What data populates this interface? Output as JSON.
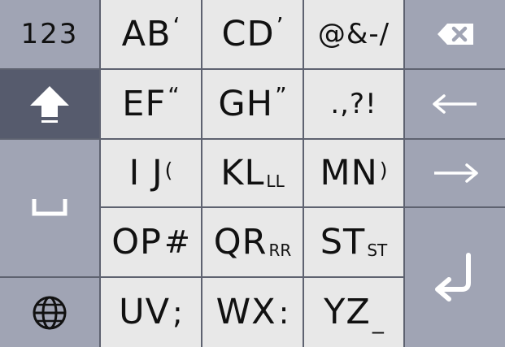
{
  "keyboard": {
    "numbers_key": "123",
    "rows": [
      [
        {
          "main": "AB",
          "mark": "‘",
          "mark_style": "sup"
        },
        {
          "main": "CD",
          "mark": "’",
          "mark_style": "sup"
        },
        {
          "main": "@&-/",
          "mark": "",
          "mark_style": "none"
        }
      ],
      [
        {
          "main": "EF",
          "mark": "“",
          "mark_style": "sup"
        },
        {
          "main": "GH",
          "mark": "”",
          "mark_style": "sup"
        },
        {
          "main": ".,?!",
          "mark": "",
          "mark_style": "none"
        }
      ],
      [
        {
          "main": "I J",
          "mark": "(",
          "mark_style": "tail-sm"
        },
        {
          "main": "KL",
          "mark": "LL",
          "mark_style": "sub"
        },
        {
          "main": "MN",
          "mark": ")",
          "mark_style": "tail-sm"
        }
      ],
      [
        {
          "main": "OP",
          "mark": "#",
          "mark_style": "tail"
        },
        {
          "main": "QR",
          "mark": "RR",
          "mark_style": "sub"
        },
        {
          "main": "ST",
          "mark": "ST",
          "mark_style": "sub"
        }
      ],
      [
        {
          "main": "UV",
          "mark": ";",
          "mark_style": "tail"
        },
        {
          "main": "WX",
          "mark": ":",
          "mark_style": "tail"
        },
        {
          "main": "YZ",
          "mark": "_",
          "mark_style": "under"
        }
      ]
    ],
    "icons": {
      "delete": "backspace-icon",
      "shift": "shift-icon",
      "space": "space-icon",
      "globe": "globe-icon",
      "left": "arrow-left-icon",
      "right": "arrow-right-icon",
      "enter": "enter-icon"
    },
    "colors": {
      "letter_key": "#e8e8e8",
      "side_key": "#a0a4b4",
      "shift_key_active": "#565b6d",
      "gap": "#5e6270",
      "glyph": "#111111",
      "icon_light": "#ffffff"
    }
  }
}
